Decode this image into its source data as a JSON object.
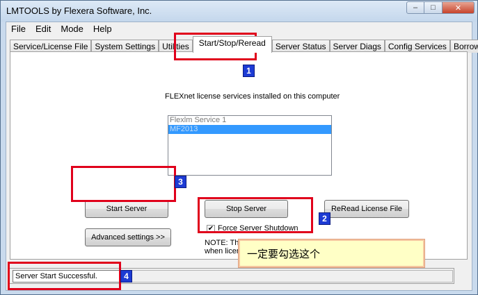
{
  "window": {
    "title": "LMTOOLS by Flexera Software, Inc.",
    "controls": {
      "minimize": "–",
      "maximize": "□",
      "close": "✕"
    }
  },
  "menu": [
    "File",
    "Edit",
    "Mode",
    "Help"
  ],
  "tabs": [
    "Service/License File",
    "System Settings",
    "Utilities",
    "Start/Stop/Reread",
    "Server Status",
    "Server Diags",
    "Config Services",
    "Borrowing"
  ],
  "active_tab_index": 3,
  "panel": {
    "services_label": "FLEXnet license services installed on this computer",
    "services": [
      "Flexlm Service 1",
      "MF2013"
    ],
    "selected_service_index": 1,
    "start_server": "Start Server",
    "stop_server": "Stop Server",
    "reread": "ReRead License File",
    "advanced": "Advanced settings >>",
    "force_shutdown_label": "Force Server Shutdown",
    "force_shutdown_checked": true,
    "note_line1": "NOTE:  This box must be checked to shut down a license server",
    "note_line2": "when licenses are borrowed."
  },
  "annotations": {
    "badges": [
      "1",
      "2",
      "3",
      "4"
    ],
    "callout_text": "一定要勾选这个",
    "colors": {
      "highlight": "#e0001b",
      "badge": "#1d3bd4"
    }
  },
  "status": {
    "message": "Server Start Successful."
  }
}
